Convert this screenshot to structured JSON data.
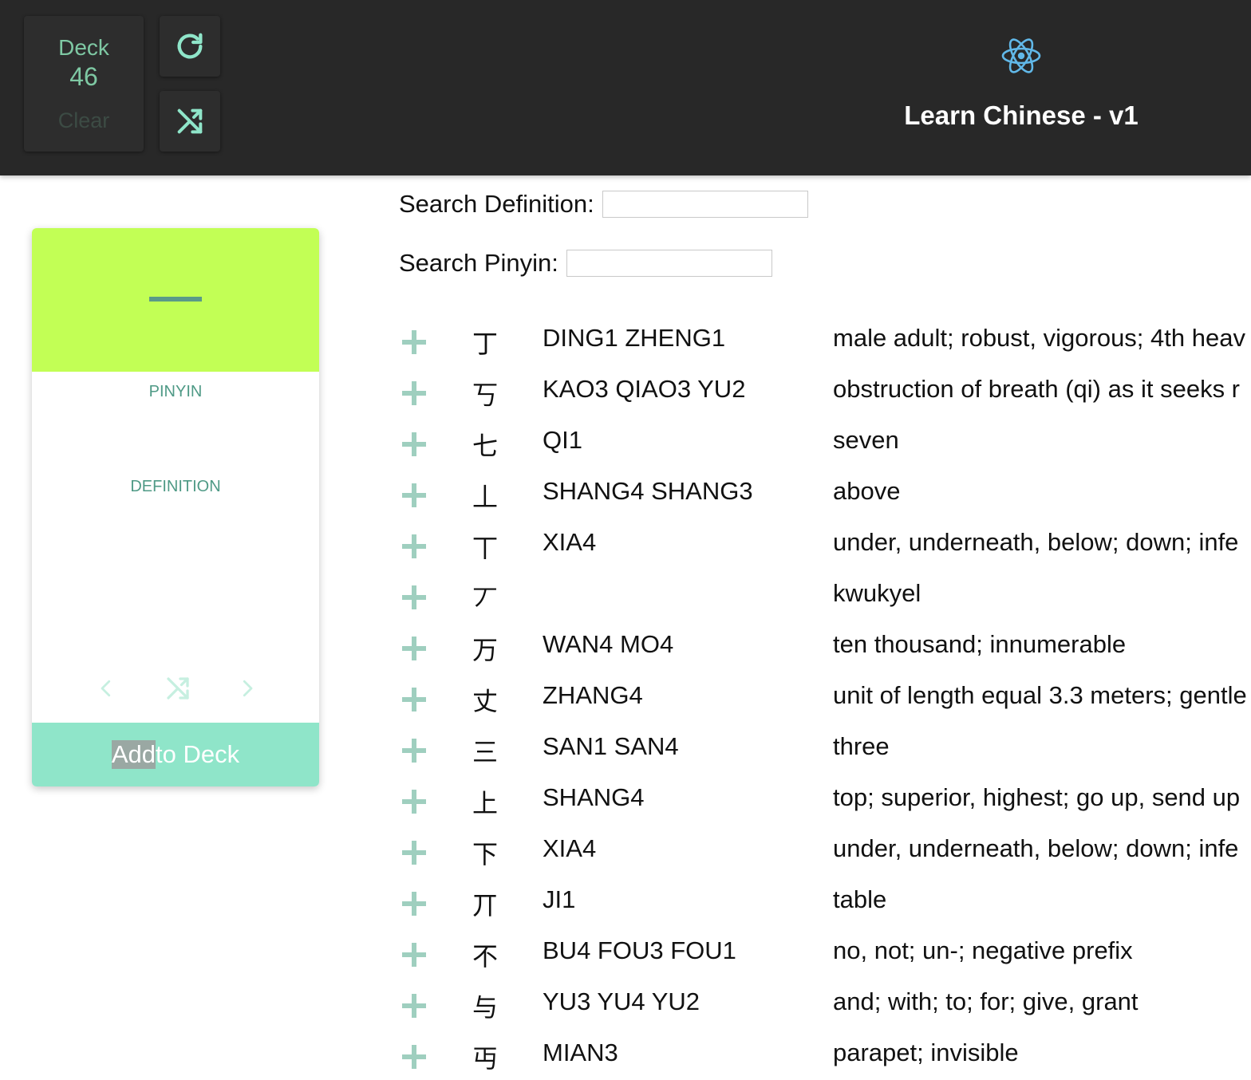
{
  "header": {
    "deck_label": "Deck",
    "deck_count": "46",
    "clear_label": "Clear",
    "title": "Learn Chinese - v1",
    "icons": [
      "refresh-icon",
      "shuffle-icon",
      "react-logo-icon"
    ]
  },
  "card": {
    "character": "一",
    "pinyin_label": "PINYIN",
    "definition_label": "DEFINITION",
    "add_label_highlight": "Add",
    "add_label_rest": " to Deck",
    "accent_color": "#c2ff55",
    "button_color": "#8fe5c9"
  },
  "search": {
    "definition_label": "Search Definition:",
    "definition_value": "",
    "pinyin_label": "Search Pinyin:",
    "pinyin_value": ""
  },
  "list": {
    "rows": [
      {
        "hanzi": "丁",
        "pinyin": "DING1 ZHENG1",
        "definition": "male adult; robust, vigorous; 4th heav"
      },
      {
        "hanzi": "丂",
        "pinyin": "KAO3 QIAO3 YU2",
        "definition": "obstruction of breath (qi) as it seeks r"
      },
      {
        "hanzi": "七",
        "pinyin": "QI1",
        "definition": "seven"
      },
      {
        "hanzi": "丄",
        "pinyin": "SHANG4 SHANG3",
        "definition": "above"
      },
      {
        "hanzi": "丅",
        "pinyin": "XIA4",
        "definition": "under, underneath, below; down; infe"
      },
      {
        "hanzi": "丆",
        "pinyin": "",
        "definition": "kwukyel"
      },
      {
        "hanzi": "万",
        "pinyin": "WAN4 MO4",
        "definition": "ten thousand; innumerable"
      },
      {
        "hanzi": "丈",
        "pinyin": "ZHANG4",
        "definition": "unit of length equal 3.3 meters; gentle"
      },
      {
        "hanzi": "三",
        "pinyin": "SAN1 SAN4",
        "definition": "three"
      },
      {
        "hanzi": "上",
        "pinyin": "SHANG4",
        "definition": "top; superior, highest; go up, send up"
      },
      {
        "hanzi": "下",
        "pinyin": "XIA4",
        "definition": "under, underneath, below; down; infe"
      },
      {
        "hanzi": "丌",
        "pinyin": "JI1",
        "definition": "table"
      },
      {
        "hanzi": "不",
        "pinyin": "BU4 FOU3 FOU1",
        "definition": "no, not; un-; negative prefix"
      },
      {
        "hanzi": "与",
        "pinyin": "YU3 YU4 YU2",
        "definition": "and; with; to; for; give, grant"
      },
      {
        "hanzi": "丏",
        "pinyin": "MIAN3",
        "definition": "parapet; invisible"
      }
    ]
  }
}
